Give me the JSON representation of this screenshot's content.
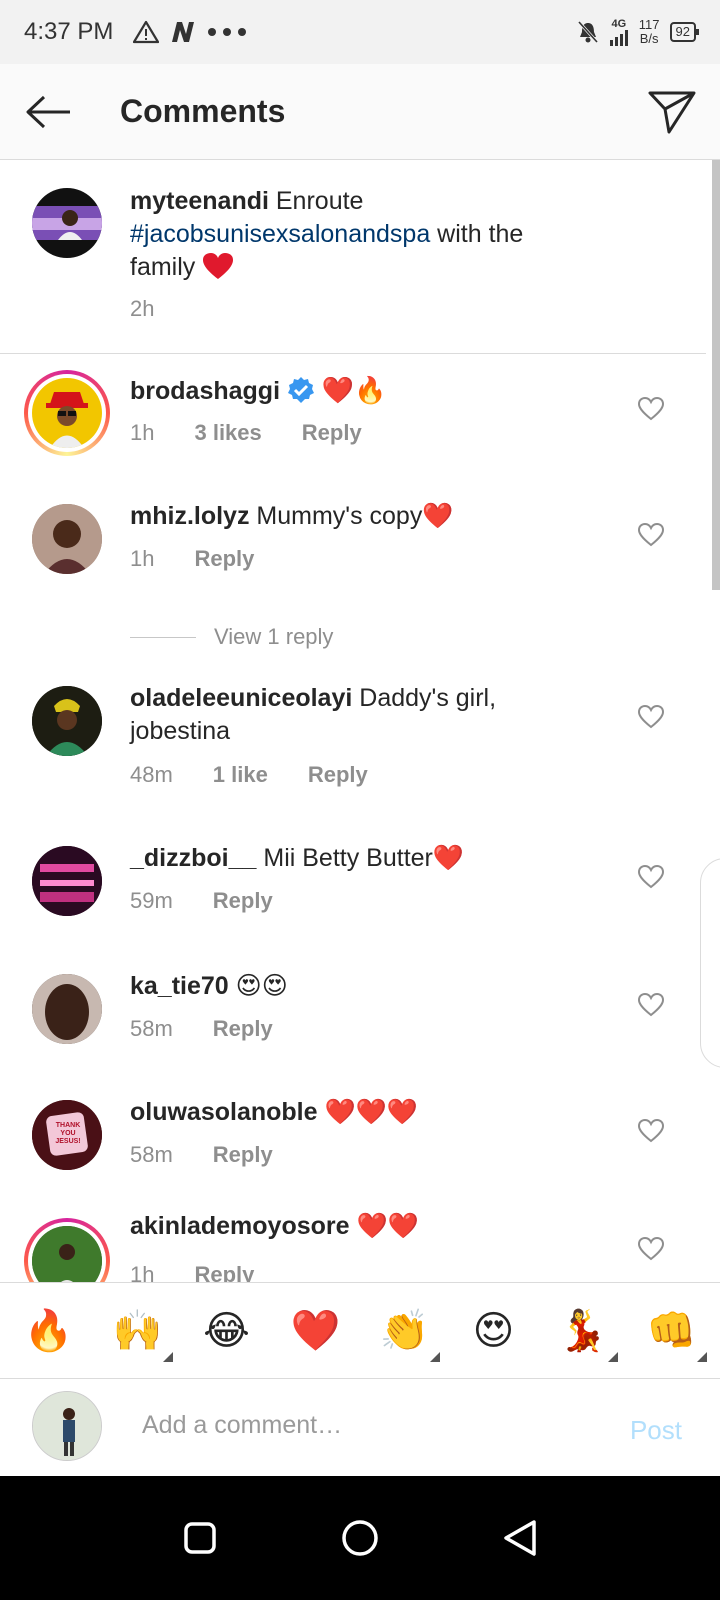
{
  "status_bar": {
    "time": "4:37 PM",
    "network_type": "4G",
    "net_speed_value": "117",
    "net_speed_unit": "B/s",
    "battery": "92"
  },
  "header": {
    "title": "Comments"
  },
  "caption": {
    "username": "myteenandi",
    "text_before": " Enroute ",
    "hashtag": "#jacobsunisexsalonandspa",
    "text_after": " with the family",
    "time": "2h"
  },
  "comments": [
    {
      "username": "brodashaggi",
      "text": "",
      "emoji": "❤️🔥",
      "time": "1h",
      "likes": "3 likes",
      "reply": "Reply",
      "verified": true
    },
    {
      "username": "mhiz.lolyz",
      "text": " Mummy's copy",
      "emoji": "❤️",
      "time": "1h",
      "likes": "",
      "reply": "Reply"
    },
    {
      "username": "oladeleeuniceolayi",
      "text": " Daddy's girl, jobestina",
      "emoji": "",
      "time": "48m",
      "likes": "1 like",
      "reply": "Reply"
    },
    {
      "username": "_dizzboi__",
      "text": " Mii Betty Butter",
      "emoji": "❤️",
      "time": "59m",
      "likes": "",
      "reply": "Reply"
    },
    {
      "username": "ka_tie70",
      "text": " ",
      "emoji": "😍😍",
      "time": "58m",
      "likes": "",
      "reply": "Reply"
    },
    {
      "username": "oluwasolanoble",
      "text": " ",
      "emoji": "❤️❤️❤️",
      "time": "58m",
      "likes": "",
      "reply": "Reply"
    },
    {
      "username": "akinlademoyosore",
      "text": " ",
      "emoji": "❤️❤️",
      "time": "1h",
      "likes": "",
      "reply": "Reply"
    }
  ],
  "view_replies": "View 1 reply",
  "avatar_badge_text": "THANK YOU JESUS!",
  "emoji_bar": [
    "🔥",
    "🙌",
    "😂",
    "❤️",
    "👏",
    "😍",
    "💃",
    "👊"
  ],
  "composer": {
    "placeholder": "Add a comment…",
    "post_label": "Post"
  },
  "colors": {
    "hashtag": "#00376b",
    "verified": "#3897f0",
    "post_disabled": "#b2dffc",
    "meta_gray": "#8e8e8e"
  }
}
